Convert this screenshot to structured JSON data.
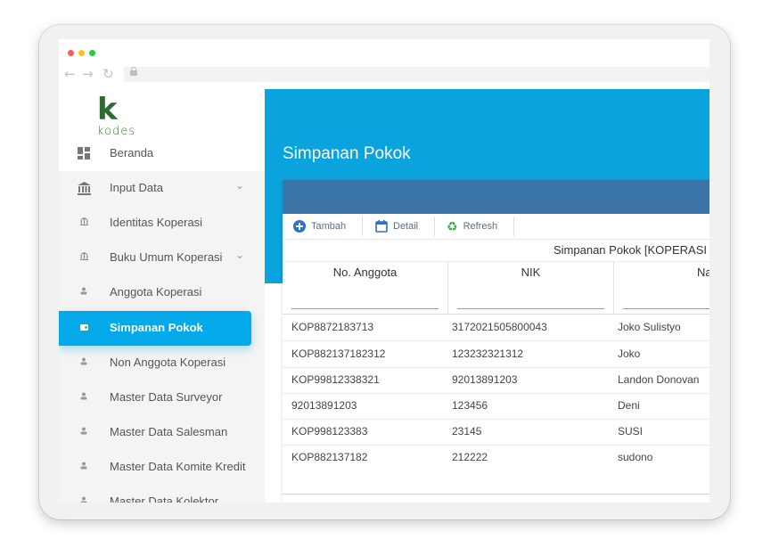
{
  "app": {
    "logo_letter": "k",
    "logo_text": "kodes"
  },
  "sidebar": {
    "items": [
      {
        "label": "Beranda",
        "icon": "dashboard-icon"
      },
      {
        "label": "Input Data",
        "icon": "bank-icon",
        "has_children": true
      },
      {
        "label": "Identitas Koperasi",
        "icon": "bank-small-icon"
      },
      {
        "label": "Buku Umum Koperasi",
        "icon": "bank-small-icon",
        "has_children": true
      },
      {
        "label": "Anggota Koperasi",
        "icon": "user-icon"
      },
      {
        "label": "Simpanan Pokok",
        "icon": "wallet-icon",
        "active": true
      },
      {
        "label": "Non Anggota Koperasi",
        "icon": "user-icon"
      },
      {
        "label": "Master Data Surveyor",
        "icon": "user-icon"
      },
      {
        "label": "Master Data Salesman",
        "icon": "user-icon"
      },
      {
        "label": "Master Data Komite Kredit",
        "icon": "user-icon"
      },
      {
        "label": "Master Data Kolektor",
        "icon": "user-icon"
      }
    ]
  },
  "main": {
    "page_title": "Simpanan Pokok",
    "toolbar": {
      "add_label": "Tambah",
      "detail_label": "Detail",
      "refresh_label": "Refresh"
    },
    "grid": {
      "caption": "Simpanan Pokok [KOPERASI S",
      "columns": [
        "No. Anggota",
        "NIK",
        "Na"
      ],
      "rows": [
        [
          "KOP8872183713",
          "3172021505800043",
          "Joko Sulistyo"
        ],
        [
          "KOP882137182312",
          "123232321312",
          "Joko"
        ],
        [
          "KOP99812338321",
          "92013891203",
          "Landon Donovan"
        ],
        [
          "92013891203",
          "123456",
          "Deni"
        ],
        [
          "KOP998123383",
          "23145",
          "SUSI"
        ],
        [
          "KOP882137182",
          "212222",
          "sudono"
        ]
      ]
    }
  },
  "colors": {
    "header_blue": "#0aa3dd",
    "panel_bar": "#3a73a6",
    "active_item": "#03a9e9"
  }
}
